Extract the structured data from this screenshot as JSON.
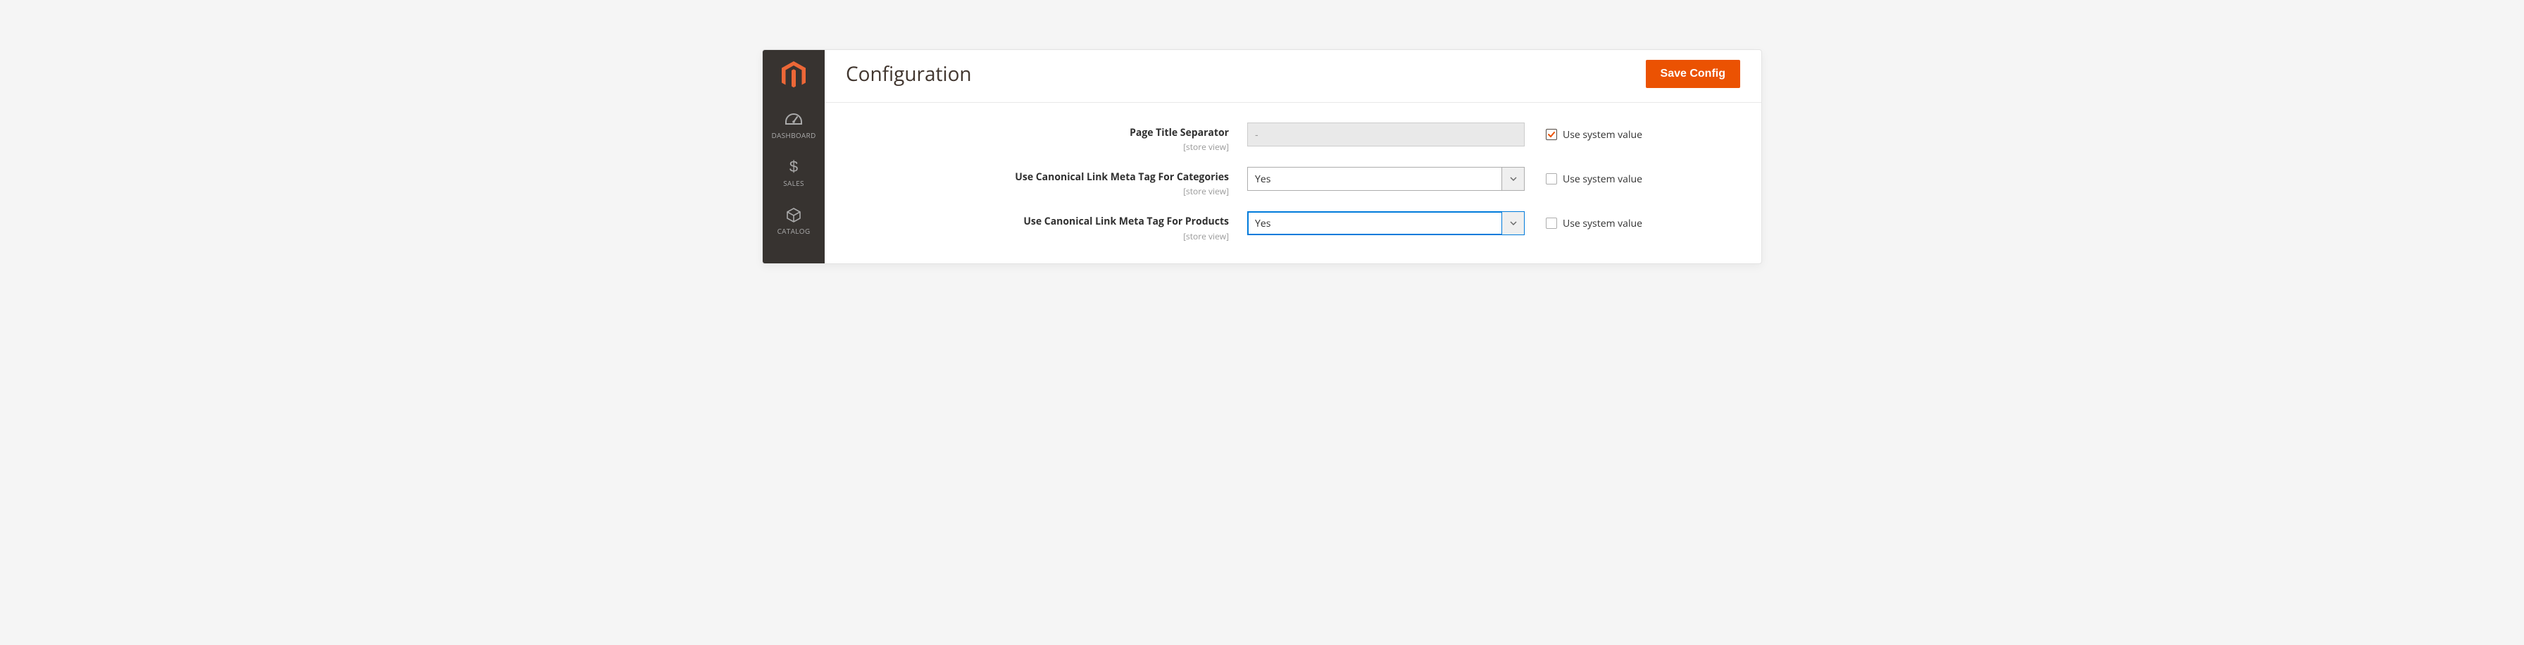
{
  "header": {
    "title": "Configuration",
    "save_label": "Save Config"
  },
  "sidebar": {
    "items": [
      {
        "id": "dashboard",
        "label": "DASHBOARD",
        "icon": "gauge-icon"
      },
      {
        "id": "sales",
        "label": "SALES",
        "icon": "dollar-icon"
      },
      {
        "id": "catalog",
        "label": "CATALOG",
        "icon": "box-icon"
      }
    ]
  },
  "form": {
    "scope_label": "[store view]",
    "use_system_value_label": "Use system value",
    "fields": [
      {
        "id": "page_title_separator",
        "label": "Page Title Separator",
        "type": "text",
        "value": "-",
        "disabled": true,
        "use_system_value": true,
        "focused": false
      },
      {
        "id": "canonical_categories",
        "label": "Use Canonical Link Meta Tag For Categories",
        "type": "select",
        "value": "Yes",
        "disabled": false,
        "use_system_value": false,
        "focused": false
      },
      {
        "id": "canonical_products",
        "label": "Use Canonical Link Meta Tag For Products",
        "type": "select",
        "value": "Yes",
        "disabled": false,
        "use_system_value": false,
        "focused": true
      }
    ]
  },
  "colors": {
    "accent": "#eb5202",
    "focus": "#007bdb",
    "sidebar_bg": "#373330"
  }
}
